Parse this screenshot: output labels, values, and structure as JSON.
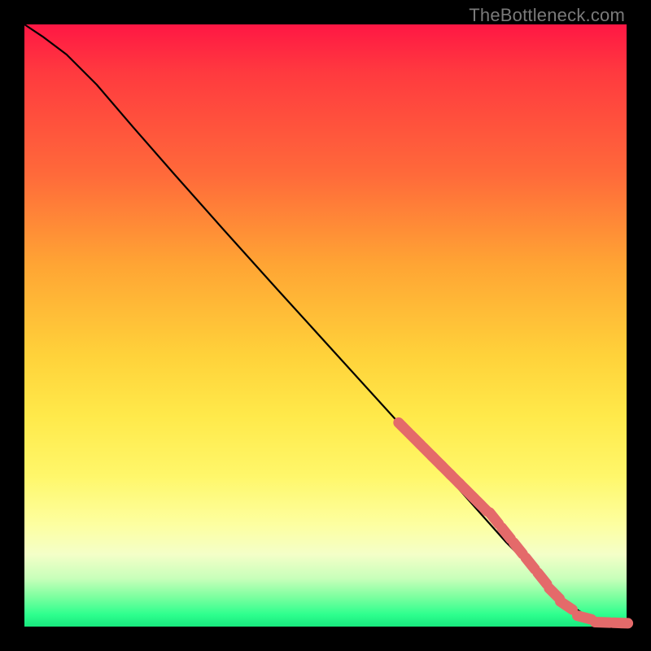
{
  "watermark": "TheBottleneck.com",
  "chart_data": {
    "type": "line",
    "title": "",
    "xlabel": "",
    "ylabel": "",
    "xlim": [
      0,
      100
    ],
    "ylim": [
      0,
      100
    ],
    "grid": false,
    "legend": false,
    "series": [
      {
        "name": "curve",
        "style": "line",
        "color": "#000000",
        "x": [
          0,
          3,
          7,
          12,
          18,
          25,
          33,
          42,
          52,
          62,
          72,
          80,
          86,
          90,
          93,
          96,
          98,
          100
        ],
        "y": [
          100,
          98,
          95,
          90,
          83,
          75,
          66,
          56,
          45,
          34,
          23,
          14,
          8,
          4,
          2,
          1,
          0.5,
          0.5
        ]
      },
      {
        "name": "markers",
        "style": "points",
        "color": "#e46a6a",
        "x": [
          63,
          65,
          67,
          68.5,
          70,
          71.5,
          73,
          74,
          75,
          76,
          78,
          80,
          82,
          84,
          86,
          88,
          90,
          93,
          96,
          99
        ],
        "y": [
          33,
          31,
          29,
          27.5,
          26,
          24.5,
          23,
          22,
          21,
          20,
          18,
          15.5,
          13,
          10.5,
          8,
          5.5,
          3.5,
          1.5,
          0.7,
          0.6
        ]
      }
    ]
  }
}
